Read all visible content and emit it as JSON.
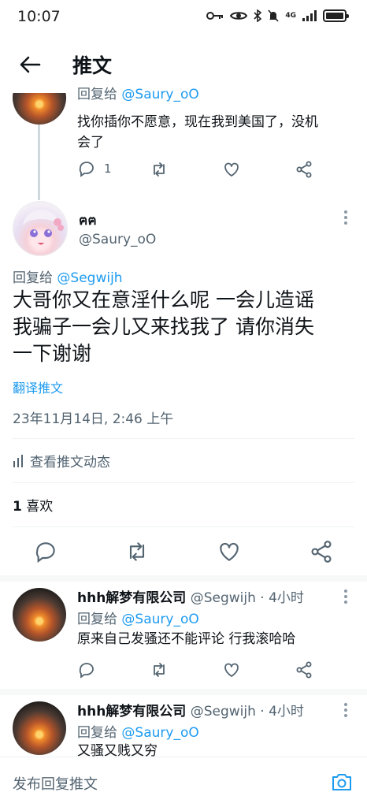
{
  "status_bar": {
    "time": "10:07",
    "network": "4G"
  },
  "header": {
    "title": "推文"
  },
  "parent_tweet": {
    "reply_label": "回复给",
    "reply_to": "@Saury_oO",
    "text_line1": "找你插你不愿意，现在我到美国了，没机",
    "text_line2": "会了",
    "reply_count": "1"
  },
  "main_tweet": {
    "display_name": "ฅฅ",
    "handle": "@Saury_oO",
    "reply_label": "回复给",
    "reply_to": "@Segwijh",
    "text_line1": "大哥你又在意淫什么呢 一会儿造谣",
    "text_line2": "我骗子一会儿又来找我了 请你消失",
    "text_line3": "一下谢谢",
    "translate": "翻译推文",
    "timestamp": "23年11月14日, 2:46 上午",
    "activity": "查看推文动态",
    "likes_count": "1",
    "likes_label": "喜欢"
  },
  "replies": [
    {
      "display_name": "hhh解梦有限公司",
      "handle": "@Segwijh",
      "time": "· 4小时",
      "reply_label": "回复给",
      "reply_to": "@Saury_oO",
      "text": "原来自己发骚还不能评论 行我滚哈哈"
    },
    {
      "display_name": "hhh解梦有限公司",
      "handle": "@Segwijh",
      "time": "· 4小时",
      "reply_label": "回复给",
      "reply_to": "@Saury_oO",
      "text": "又骚又贱又穷"
    }
  ],
  "compose": {
    "placeholder": "发布回复推文"
  },
  "colors": {
    "accent": "#1d9bf0",
    "text": "#0f1419",
    "muted": "#536471"
  }
}
